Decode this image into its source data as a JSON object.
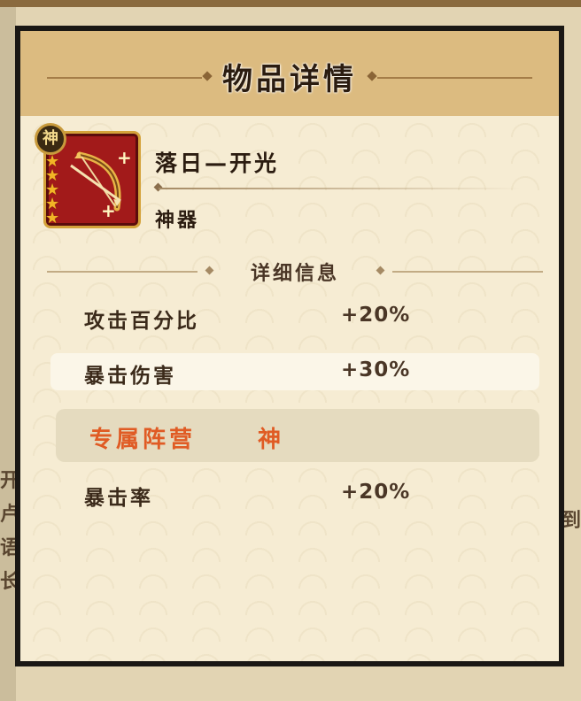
{
  "panel": {
    "title": "物品详情"
  },
  "item": {
    "name": "落日—开光",
    "type": "神器",
    "badge": "神",
    "stars": 5,
    "icon": "golden-bow-icon"
  },
  "details": {
    "section_label": "详细信息",
    "stats": [
      {
        "label": "攻击百分比",
        "value": "+20%"
      },
      {
        "label": "暴击伤害",
        "value": "+30%"
      }
    ],
    "exclusive": {
      "label": "专属阵营",
      "value": "神"
    },
    "extra_stats": [
      {
        "label": "暴击率",
        "value": "+20%"
      }
    ]
  },
  "background": {
    "left_fragments": [
      "开",
      "卢",
      "语",
      "长"
    ],
    "right_fragment": "到"
  },
  "colors": {
    "accent": "#e05b24",
    "header": "#dcbb80",
    "panel": "#f6ecd3",
    "border": "#1a1714"
  }
}
